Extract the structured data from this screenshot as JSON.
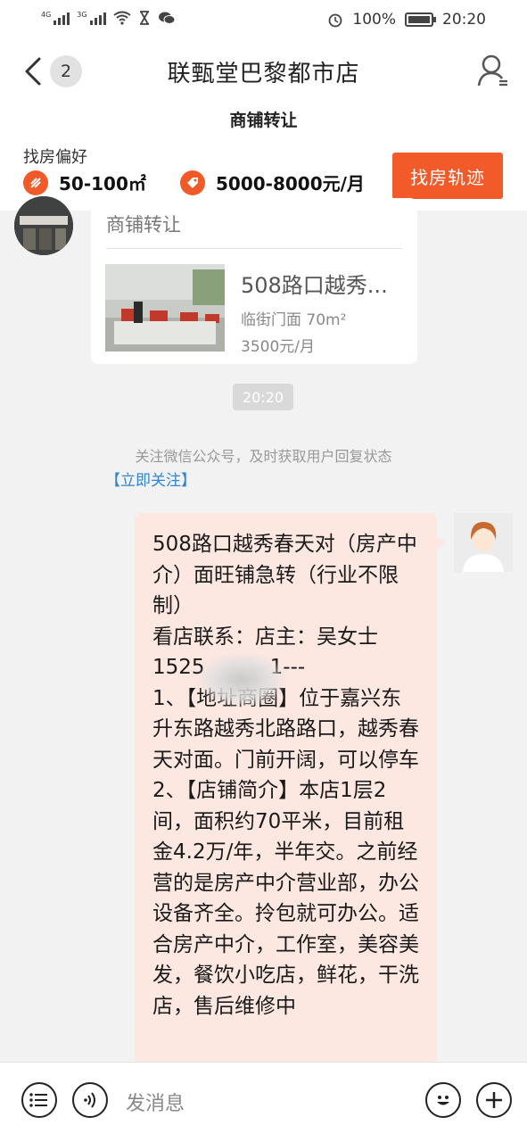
{
  "status_bar": {
    "signal1_label": "4G",
    "signal2_label": "3G",
    "battery_percent": "100%",
    "time": "20:20"
  },
  "header": {
    "back_icon": "chevron-left-icon",
    "unread_count": "2",
    "title": "联甄堂巴黎都市店",
    "user_icon": "user-icon",
    "subtitle": "商铺转让"
  },
  "preferences": {
    "label": "找房偏好",
    "area": "50-100㎡",
    "price": "5000-8000元/月",
    "track_button": "找房轨迹"
  },
  "chat": {
    "card": {
      "title": "商铺转让",
      "name": "508路口越秀...",
      "info": "临街门面 70m²",
      "price": "3500元/月"
    },
    "timestamp": "20:20",
    "notice": "关注微信公众号，及时获取用户回复状态",
    "follow_link": "【立即关注】",
    "message": "508路口越秀春天对（房产中介）面旺铺急转（行业不限制）\n看店联系：店主：吴女士\n1525          1---\n1、【地址商圈】位于嘉兴东升东路越秀北路路口，越秀春天对面。门前开阔，可以停车\n2、【店铺简介】本店1层2间，面积约70平米，目前租金4.2万/年，半年交。之前经营的是房产中介营业部，办公设备齐全。拎包就可办公。适合房产中介，工作室，美容美发，餐饮小吃店，鲜花，干洗店，售后维修中"
  },
  "input_bar": {
    "placeholder": "发消息"
  },
  "colors": {
    "accent": "#f25a29",
    "bubble": "#fde7e1",
    "link": "#2f84d6"
  }
}
